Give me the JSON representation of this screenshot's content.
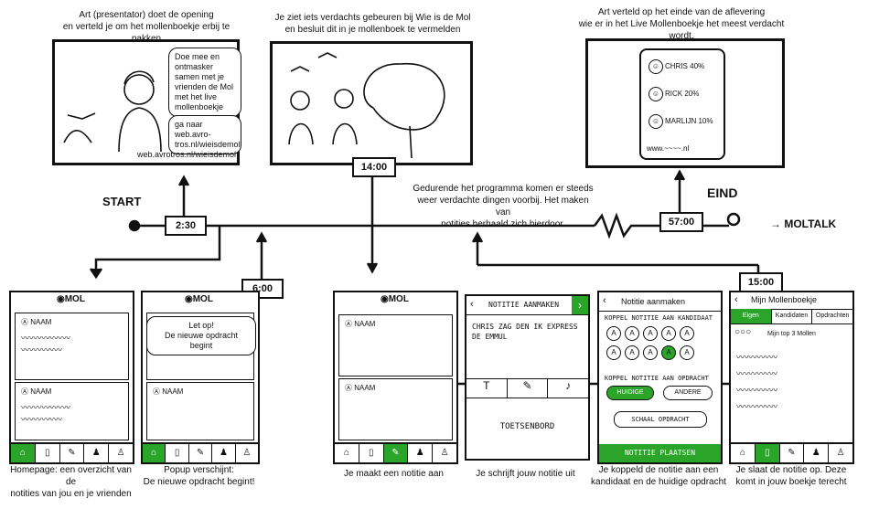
{
  "panels": {
    "p1": {
      "caption": "Art (presentator) doet de opening\nen verteld je om het mollenboekje erbij te pakken",
      "bubble1": "Doe mee en ontmasker samen met je vrienden de Mol met het live mollenboekje",
      "bubble2": "ga naar web.avro-tros.nl/wieisdemol",
      "url": "web.avrotros.nl/wieisdemol"
    },
    "p2": {
      "caption": "Je ziet iets verdachts gebeuren bij Wie is de Mol\nen besluit dit in je mollenboek te vermelden"
    },
    "p3": {
      "caption": "Art verteld op het einde van de aflevering\nwie er in het Live Mollenboekje het meest verdacht wordt.",
      "suspects": [
        {
          "name": "CHRIS",
          "pct": "40%"
        },
        {
          "name": "RICK",
          "pct": "20%"
        },
        {
          "name": "MARLIJN",
          "pct": "10%"
        }
      ],
      "url": "www.~~~~.nl"
    }
  },
  "timeline": {
    "start": "START",
    "end": "EIND",
    "moltalk": "→ MOLTALK",
    "t1": "2:30",
    "t2": "14:00",
    "t3": "57:00",
    "t4": "6:00",
    "t5": "15:00",
    "mid_caption": "Gedurende het programma komen er steeds\nweer verdachte dingen voorbij. Het maken van\nnotities herhaald zich hierdoor."
  },
  "screens": {
    "s1": {
      "caption": "Homepage: een overzicht van de\nnotities van jou en je vrienden",
      "name": "NAAM"
    },
    "s2": {
      "caption": "Popup verschijnt:\nDe nieuwe opdracht begint!",
      "popup": "Let op!\nDe nieuwe opdracht begint",
      "name": "NAAM"
    },
    "s3": {
      "caption": "Je maakt een notitie aan",
      "name": "NAAM"
    },
    "s4": {
      "caption": "Je schrijft jouw notitie uit",
      "title": "NOTITIE AANMAKEN",
      "text": "CHRIS ZAG DEN IK EXPRESS DE EMMUL",
      "keyboard": "TOETSENBORD"
    },
    "s5": {
      "caption": "Je koppeld de notitie aan een\nkandidaat en de huidige opdracht",
      "title": "Notitie aanmaken",
      "link1": "KOPPEL NOTITIE AAN KANDIDAAT",
      "link2": "KOPPEL NOTITIE AAN OPDRACHT",
      "btn1": "HUIDIGE",
      "btn2": "ANDERE",
      "btn3": "SCHAAL OPDRACHT",
      "submit": "NOTITIE PLAATSEN"
    },
    "s6": {
      "caption": "Je slaat de notitie op. Deze\nkomt in jouw boekje terecht",
      "title": "Mijn Mollenboekje",
      "tabs": [
        "Eigen",
        "Kandidaten",
        "Opdrachten"
      ],
      "top3": "Mijn top 3 Mollen"
    }
  }
}
